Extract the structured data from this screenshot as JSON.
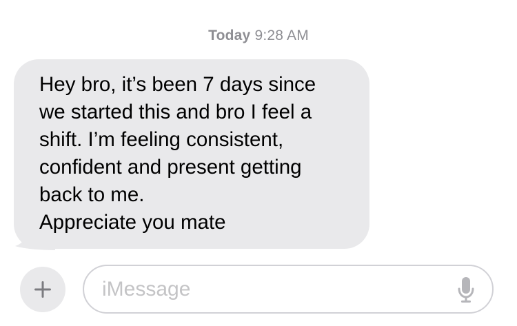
{
  "thread": {
    "timestamp_day": "Today",
    "timestamp_time": "9:28 AM"
  },
  "message": {
    "lines": [
      "Hey bro, it’s been 7 days since",
      "we started this and bro I feel a",
      "shift. I’m feeling consistent,",
      "confident and present getting",
      "back to me.",
      "Appreciate you mate"
    ],
    "bubble_color": "#e9e9eb",
    "text_color": "#000000"
  },
  "composer": {
    "placeholder": "iMessage",
    "plus_icon": "plus-icon",
    "mic_icon": "microphone-icon",
    "placeholder_color": "#c4c4c6"
  }
}
